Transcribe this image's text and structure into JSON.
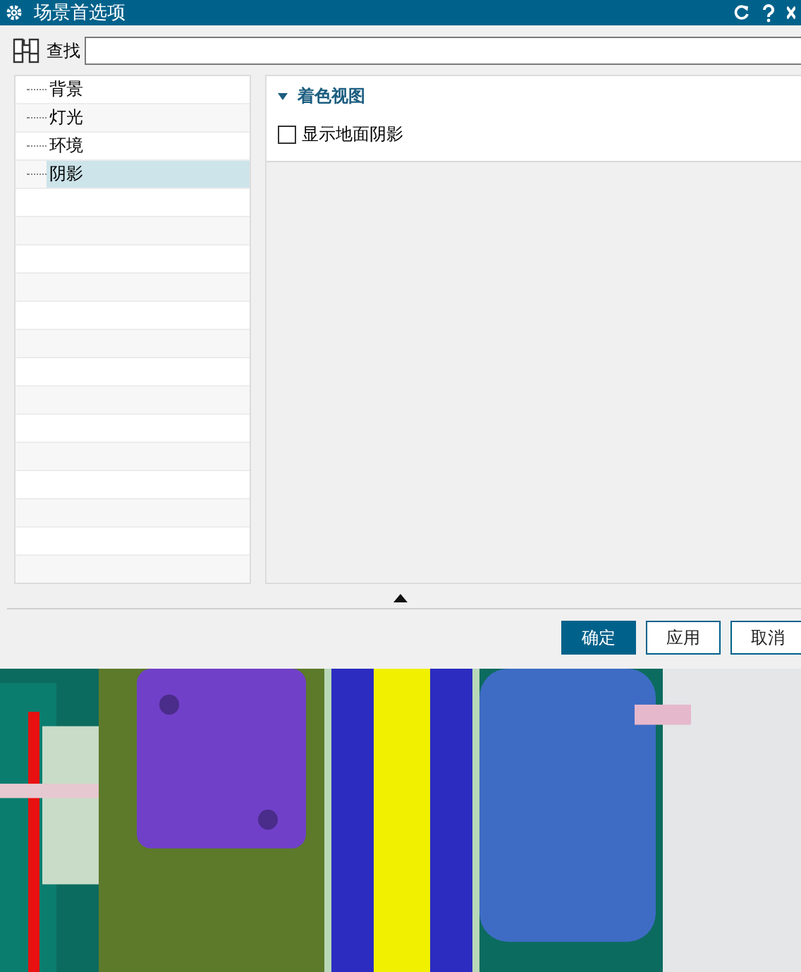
{
  "window": {
    "title": "场景首选项"
  },
  "search": {
    "label": "查找"
  },
  "tree": {
    "items": [
      {
        "label": "背景",
        "selected": false
      },
      {
        "label": "灯光",
        "selected": false
      },
      {
        "label": "环境",
        "selected": false
      },
      {
        "label": "阴影",
        "selected": true
      }
    ]
  },
  "section": {
    "title": "着色视图",
    "expanded": true,
    "options": [
      {
        "label": "显示地面阴影",
        "checked": false
      }
    ]
  },
  "buttons": [
    {
      "label": "确定",
      "kind": "primary"
    },
    {
      "label": "应用",
      "kind": "normal"
    },
    {
      "label": "取消",
      "kind": "normal"
    }
  ]
}
